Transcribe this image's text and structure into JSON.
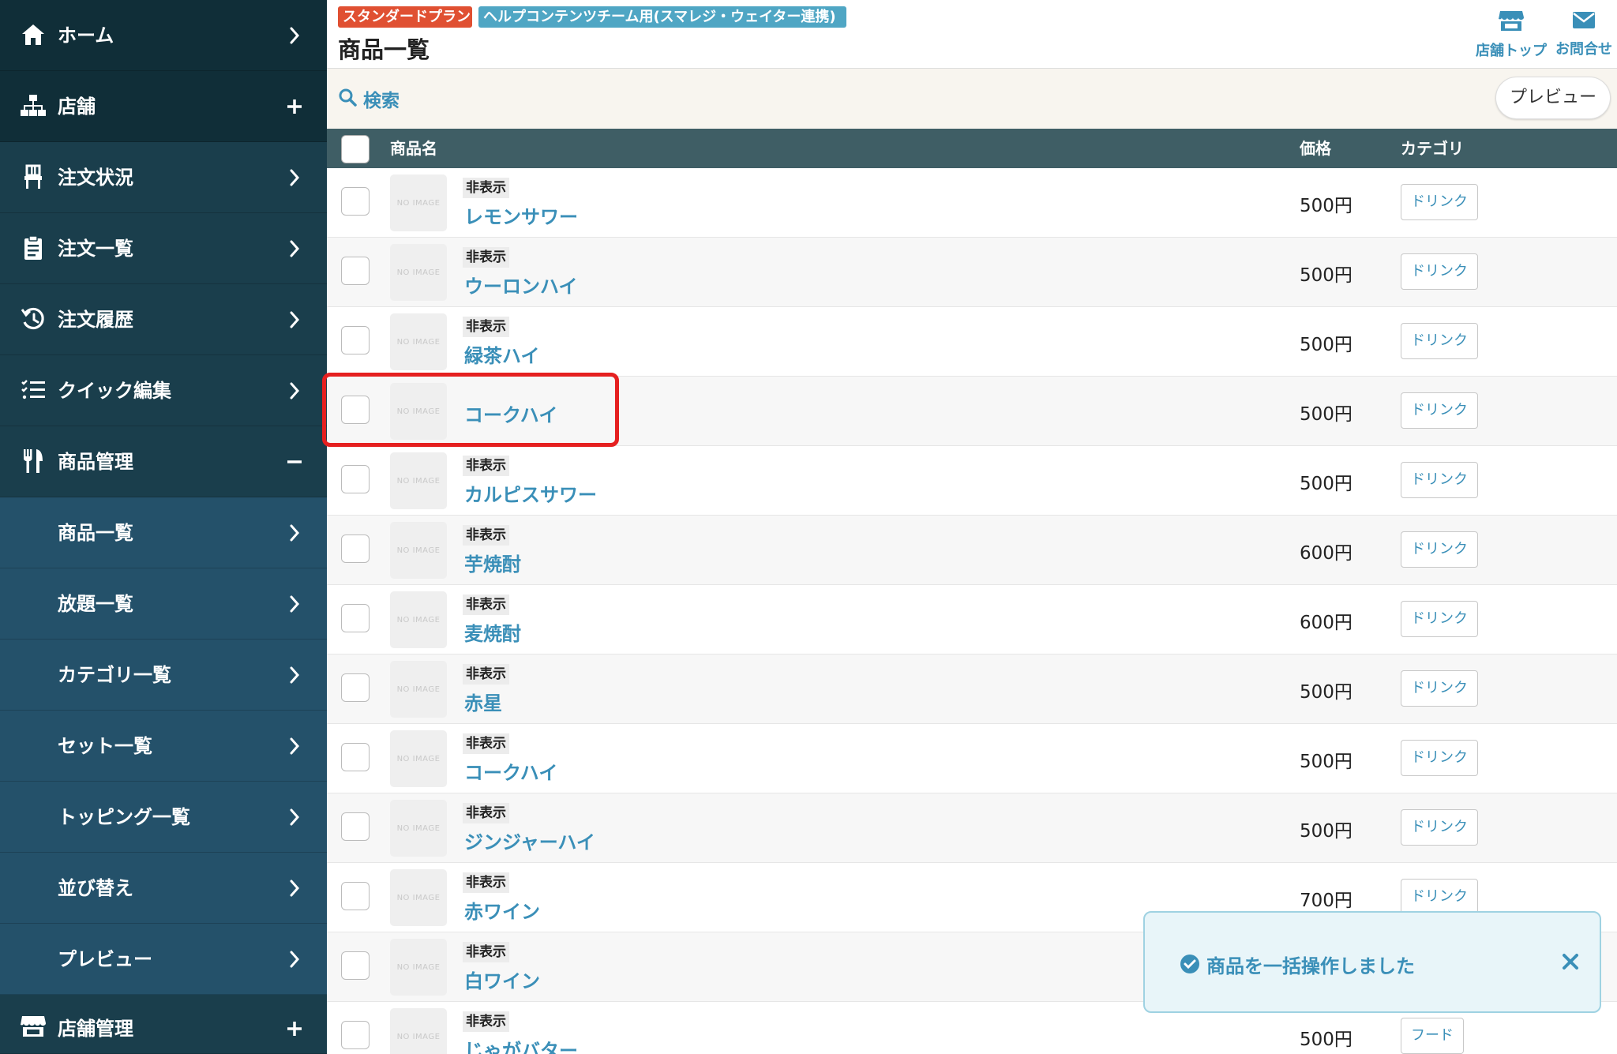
{
  "sidebar": {
    "items": [
      {
        "label": "ホーム",
        "icon": "home-icon",
        "trail": "chevron-right-icon"
      },
      {
        "label": "店舗",
        "icon": "sitemap-icon",
        "trail": "plus-icon"
      },
      {
        "label": "注文状況",
        "icon": "chair-icon",
        "trail": "chevron-right-icon"
      },
      {
        "label": "注文一覧",
        "icon": "clipboard-icon",
        "trail": "chevron-right-icon"
      },
      {
        "label": "注文履歴",
        "icon": "history-icon",
        "trail": "chevron-right-icon"
      },
      {
        "label": "クイック編集",
        "icon": "list-check-icon",
        "trail": "chevron-right-icon"
      },
      {
        "label": "商品管理",
        "icon": "utensils-icon",
        "trail": "minus-icon"
      },
      {
        "label": "商品一覧",
        "trail": "chevron-right-icon"
      },
      {
        "label": "放題一覧",
        "trail": "chevron-right-icon"
      },
      {
        "label": "カテゴリ一覧",
        "trail": "chevron-right-icon"
      },
      {
        "label": "セット一覧",
        "trail": "chevron-right-icon"
      },
      {
        "label": "トッピング一覧",
        "trail": "chevron-right-icon"
      },
      {
        "label": "並び替え",
        "trail": "chevron-right-icon"
      },
      {
        "label": "プレビュー",
        "trail": "chevron-right-icon"
      },
      {
        "label": "店舗管理",
        "icon": "store-icon",
        "trail": "plus-icon"
      }
    ]
  },
  "header": {
    "plan_badge": "スタンダードプラン",
    "team_badge": "ヘルプコンテンツチーム用(スマレジ・ウェイター連携)",
    "title": "商品一覧",
    "store_top_label": "店舗トップ",
    "contact_label": "お問合せ"
  },
  "search": {
    "label": "検索",
    "preview_label": "プレビュー"
  },
  "table": {
    "columns": {
      "name": "商品名",
      "price": "価格",
      "category": "カテゴリ"
    },
    "no_image_text": "NO IMAGE",
    "rows": [
      {
        "tag": "非表示",
        "name": "レモンサワー",
        "price": "500円",
        "category": "ドリンク"
      },
      {
        "tag": "非表示",
        "name": "ウーロンハイ",
        "price": "500円",
        "category": "ドリンク"
      },
      {
        "tag": "非表示",
        "name": "緑茶ハイ",
        "price": "500円",
        "category": "ドリンク"
      },
      {
        "tag": "",
        "name": "コークハイ",
        "price": "500円",
        "category": "ドリンク"
      },
      {
        "tag": "非表示",
        "name": "カルピスサワー",
        "price": "500円",
        "category": "ドリンク"
      },
      {
        "tag": "非表示",
        "name": "芋焼酎",
        "price": "600円",
        "category": "ドリンク"
      },
      {
        "tag": "非表示",
        "name": "麦焼酎",
        "price": "600円",
        "category": "ドリンク"
      },
      {
        "tag": "非表示",
        "name": "赤星",
        "price": "500円",
        "category": "ドリンク"
      },
      {
        "tag": "非表示",
        "name": "コークハイ",
        "price": "500円",
        "category": "ドリンク"
      },
      {
        "tag": "非表示",
        "name": "ジンジャーハイ",
        "price": "500円",
        "category": "ドリンク"
      },
      {
        "tag": "非表示",
        "name": "赤ワイン",
        "price": "700円",
        "category": "ドリンク"
      },
      {
        "tag": "非表示",
        "name": "白ワイン",
        "price": "",
        "category": ""
      },
      {
        "tag": "非表示",
        "name": "じゃがバター",
        "price": "500円",
        "category": "フード"
      }
    ]
  },
  "toast": {
    "message": "商品を一括操作しました"
  },
  "colors": {
    "sidebar_bg": "#21495a",
    "accent": "#3a8fb8",
    "plan_badge": "#e05032",
    "team_badge": "#4fa6c4",
    "table_header": "#3f5e65",
    "highlight": "#e52020"
  }
}
